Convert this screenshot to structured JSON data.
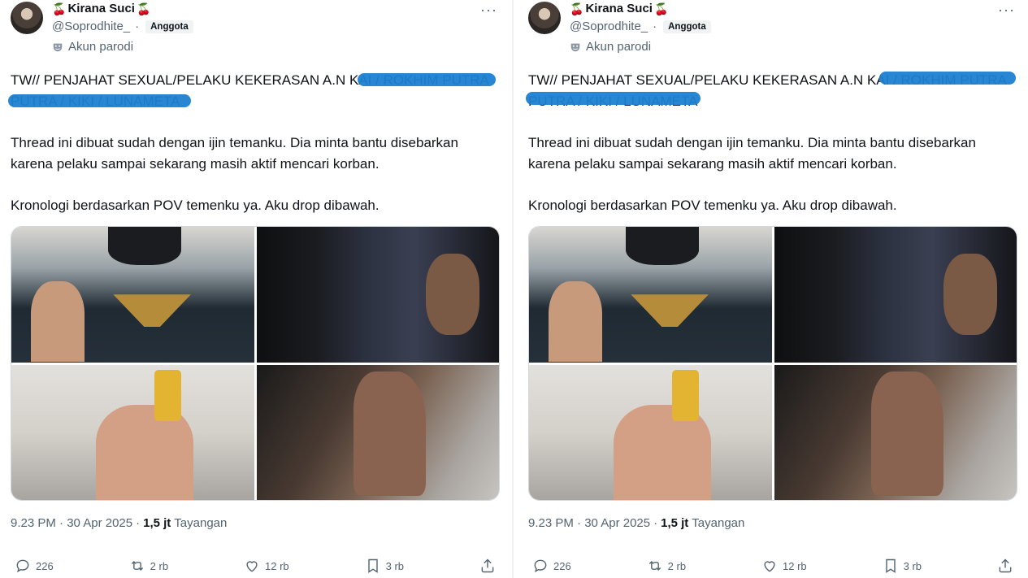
{
  "tweets": [
    {
      "author": {
        "name": "Kirana Suci",
        "emoji": "🍒",
        "handle": "@Soprodhite_",
        "separator": "·",
        "badge": "Anggota",
        "parody_label": "Akun parodi"
      },
      "more_label": "···",
      "text": {
        "line1": "TW// PENJAHAT SEXUAL/PELAKU KEKERASAN A.N KAI / ROKHIM PUTRA",
        "line2": "PUTRA / KIKI / LUNAMETA",
        "para1": "Thread ini dibuat sudah dengan ijin temanku. Dia minta bantu disebarkan karena pelaku sampai sekarang masih aktif mencari korban.",
        "para2": "Kronologi berdasarkan POV temenku ya. Aku drop dibawah."
      },
      "meta": {
        "time": "9.23 PM · 30 Apr 2025",
        "dot": "·",
        "views_value": "1,5 jt",
        "views_label": "Tayangan"
      },
      "actions": {
        "replies": "226",
        "reposts": "2 rb",
        "likes": "12 rb",
        "bookmarks": "3 rb"
      }
    },
    {
      "author": {
        "name": "Kirana Suci",
        "emoji": "🍒",
        "handle": "@Soprodhite_",
        "separator": "·",
        "badge": "Anggota",
        "parody_label": "Akun parodi"
      },
      "more_label": "···",
      "text": {
        "line1": "TW// PENJAHAT SEXUAL/PELAKU KEKERASAN A.N KAI / ROKHIM PUTRA",
        "line2": "PUTRA / KIKI / LUNAMETA",
        "para1": "Thread ini dibuat sudah dengan ijin temanku. Dia minta bantu disebarkan karena pelaku sampai sekarang masih aktif mencari korban.",
        "para2": "Kronologi berdasarkan POV temenku ya. Aku drop dibawah."
      },
      "meta": {
        "time": "9.23 PM · 30 Apr 2025",
        "dot": "·",
        "views_value": "1,5 jt",
        "views_label": "Tayangan"
      },
      "actions": {
        "replies": "226",
        "reposts": "2 rb",
        "likes": "12 rb",
        "bookmarks": "3 rb"
      }
    }
  ],
  "colors": {
    "scribble": "#1d7fd1",
    "muted": "#536471",
    "text": "#0f1419"
  }
}
